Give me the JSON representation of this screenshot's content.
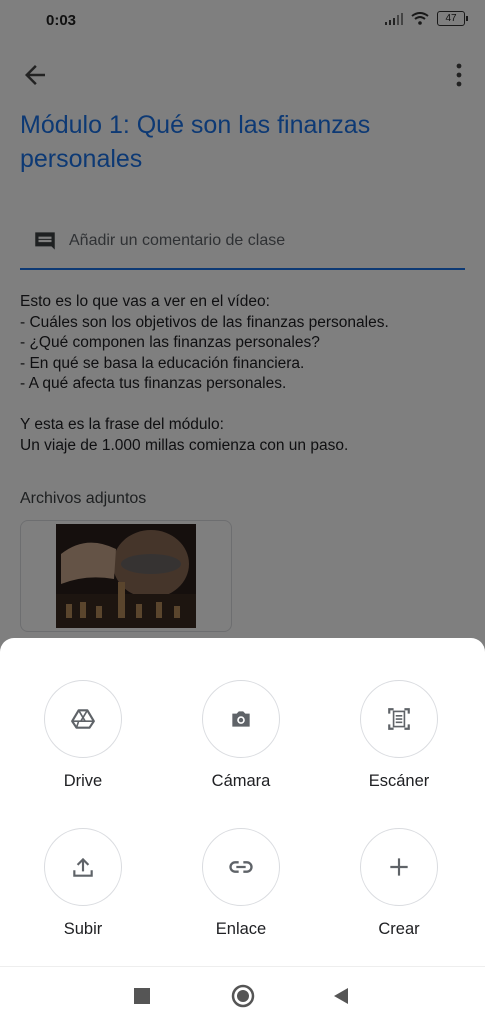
{
  "status_bar": {
    "time": "0:03",
    "battery": "47"
  },
  "header": {
    "title": "Módulo 1: Qué son las finanzas personales"
  },
  "comment": {
    "placeholder": "Añadir un comentario de clase"
  },
  "description": {
    "lines": [
      "Esto es lo que vas a ver en el vídeo:",
      "- Cuáles son los objetivos de las finanzas personales.",
      "- ¿Qué componen las finanzas personales?",
      "- En qué se basa la educación financiera.",
      "- A qué afecta tus finanzas personales.",
      "",
      "Y esta es la frase del módulo:",
      "Un viaje de 1.000 millas comienza con un paso."
    ]
  },
  "attachments": {
    "label": "Archivos adjuntos"
  },
  "sheet": {
    "options": [
      {
        "label": "Drive",
        "icon": "drive-icon"
      },
      {
        "label": "Cámara",
        "icon": "camera-icon"
      },
      {
        "label": "Escáner",
        "icon": "scanner-icon"
      },
      {
        "label": "Subir",
        "icon": "upload-icon"
      },
      {
        "label": "Enlace",
        "icon": "link-icon"
      },
      {
        "label": "Crear",
        "icon": "plus-icon"
      }
    ]
  },
  "colors": {
    "accent": "#1a73e8",
    "icon": "#5f6368",
    "scrim": "rgba(0,0,0,0.5)"
  }
}
